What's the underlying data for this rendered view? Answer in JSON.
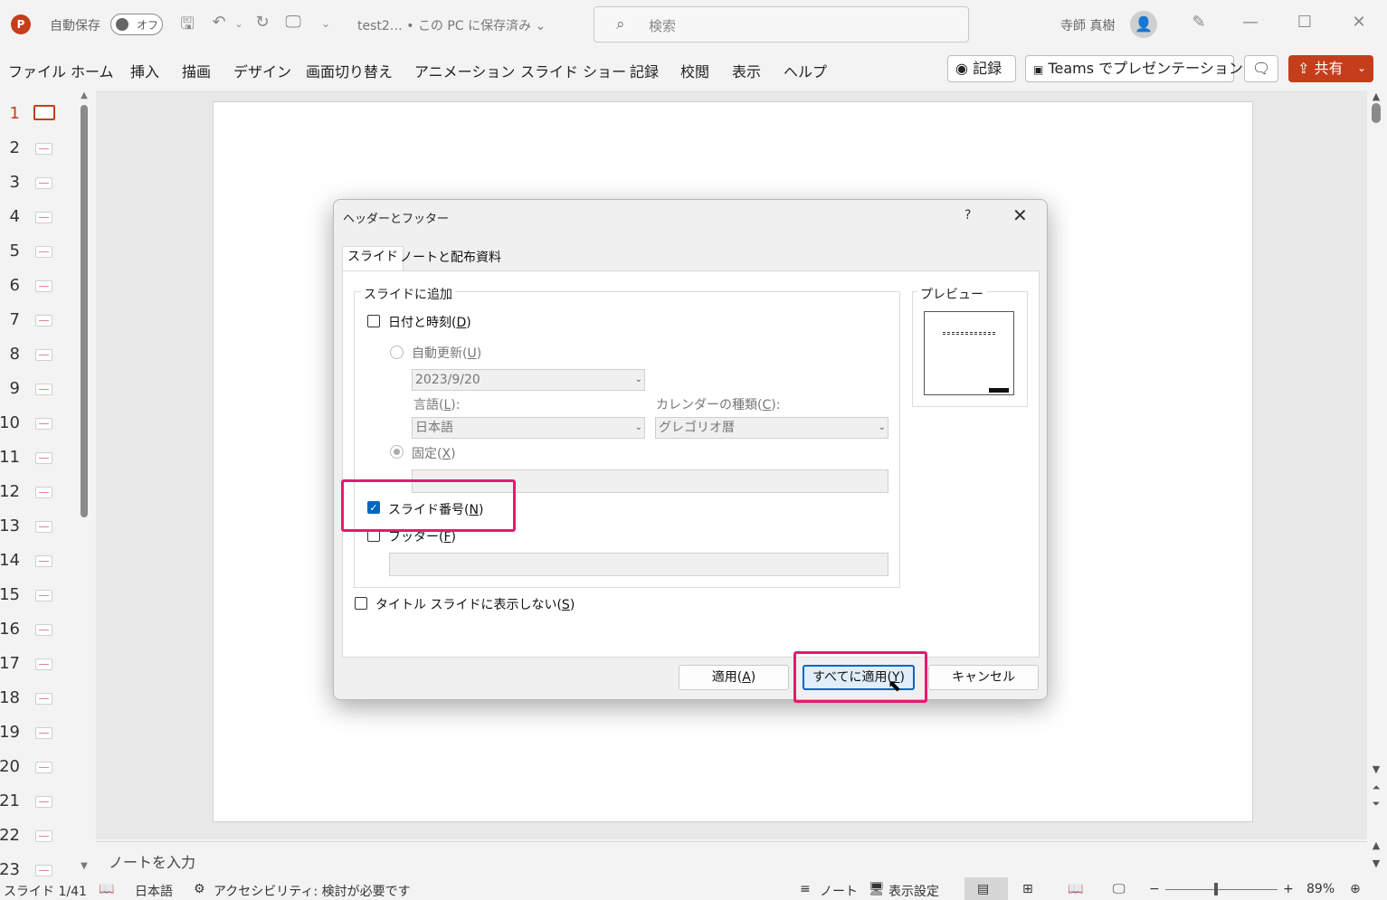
{
  "titlebar": {
    "logo_letter": "P",
    "autosave_label": "自動保存",
    "autosave_state": "オフ",
    "doc_title": "test2…  • この PC に保存済み ⌄",
    "search_placeholder": "検索",
    "username": "寺師 真樹"
  },
  "menu": {
    "items": [
      "ファイル",
      "ホーム",
      "挿入",
      "描画",
      "デザイン",
      "画面切り替え",
      "アニメーション",
      "スライド ショー",
      "記録",
      "校閲",
      "表示",
      "ヘルプ"
    ],
    "record_button": "記録",
    "teams_button": "Teams でプレゼンテーション",
    "share_button": "共有"
  },
  "thumbnails": {
    "numbers": [
      "1",
      "2",
      "3",
      "4",
      "5",
      "6",
      "7",
      "8",
      "9",
      "10",
      "11",
      "12",
      "13",
      "14",
      "15",
      "16",
      "17",
      "18",
      "19",
      "20",
      "21",
      "22",
      "23"
    ],
    "active_index": 0
  },
  "notes_placeholder": "ノートを入力",
  "statusbar": {
    "slide_indicator": "スライド 1/41",
    "language": "日本語",
    "accessibility": "アクセシビリティ: 検討が必要です",
    "notes_label": "ノート",
    "display_settings": "表示設定",
    "zoom_minus": "−",
    "zoom_plus": "+",
    "zoom_level": "89%",
    "zoom_fraction": 0.45
  },
  "dialog": {
    "title": "ヘッダーとフッター",
    "help": "?",
    "tabs": [
      "スライド",
      "ノートと配布資料"
    ],
    "group_label": "スライドに追加",
    "date_time": {
      "label": "日付と時刻(",
      "key": "D",
      "checked": false
    },
    "auto_update": {
      "label": "自動更新(",
      "key": "U",
      "selected": false
    },
    "date_value": "2023/9/20",
    "language_label": "言語(",
    "language_key": "L",
    "language_value": "日本語",
    "calendar_label": "カレンダーの種類(",
    "calendar_key": "C",
    "calendar_value": "グレゴリオ暦",
    "fixed": {
      "label": "固定(",
      "key": "X",
      "selected": true
    },
    "slide_number": {
      "label": "スライド番号(",
      "key": "N",
      "checked": true
    },
    "footer": {
      "label": "フッター(",
      "key": "F",
      "checked": false
    },
    "no_title_slide": {
      "label": "タイトル スライドに表示しない(",
      "key": "S",
      "checked": false
    },
    "preview_label": "プレビュー",
    "buttons": {
      "apply": {
        "label": "適用(",
        "key": "A"
      },
      "apply_all": {
        "label": "すべてに適用(",
        "key": "Y"
      },
      "cancel": "キャンセル"
    }
  },
  "colors": {
    "accent": "#c43e1c",
    "highlight": "#e8196f",
    "checkbox": "#0067c0"
  }
}
